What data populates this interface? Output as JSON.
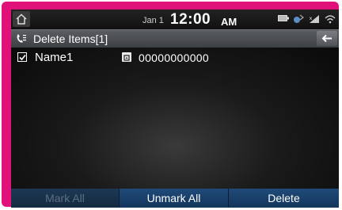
{
  "status": {
    "date": "Jan 1",
    "time": "12:00",
    "ampm": "AM",
    "icons": [
      "home-icon",
      "battery-icon",
      "bluetooth-icon",
      "signal-icon",
      "wifi-icon"
    ]
  },
  "header": {
    "title": "Delete Items[1]",
    "title_icon": "phonebook-icon",
    "back_icon": "back-arrow-icon"
  },
  "list": {
    "items": [
      {
        "name": "Name1",
        "number": "00000000000",
        "checked": true,
        "type_icon": "phone-type-icon"
      }
    ]
  },
  "buttons": {
    "mark_all": "Mark All",
    "unmark_all": "Unmark All",
    "delete": "Delete"
  },
  "colors": {
    "frame": "#e0127a",
    "button": "#1f4a78",
    "disabled_text": "#5d6f82"
  }
}
